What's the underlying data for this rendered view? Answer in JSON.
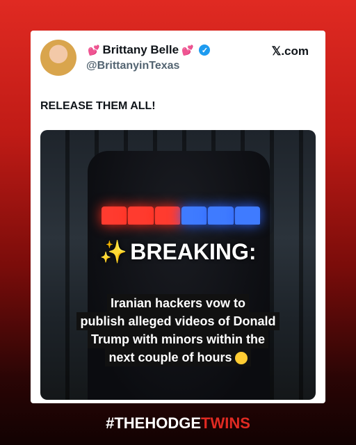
{
  "post": {
    "author": "Brittany Belle",
    "handle": "@BrittanyinTexas",
    "source": "𝕏.com",
    "text": "RELEASE THEM ALL!",
    "icons": [
      "heart-emoji",
      "verified-badge"
    ]
  },
  "media": {
    "headline": "BREAKING:",
    "caption_lines": [
      "Iranian hackers vow to",
      "publish alleged videos of Donald",
      "Trump with minors within the",
      "next couple of hours"
    ]
  },
  "footer": {
    "tag_main": "#THEHODGE",
    "tag_accent": "TWINS"
  },
  "colors": {
    "brand_red": "#e02a22",
    "verified_blue": "#1d9bf0"
  }
}
